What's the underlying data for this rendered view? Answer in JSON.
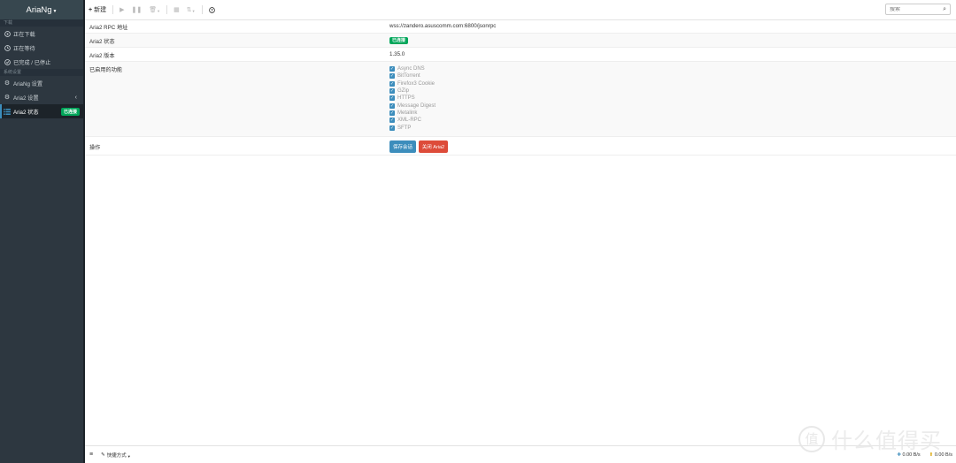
{
  "brand": {
    "title": "AriaNg"
  },
  "sidebar": {
    "section_downloads": "下载",
    "downloads": [
      {
        "label": "正在下载",
        "icon": "play-circle-icon"
      },
      {
        "label": "正在等待",
        "icon": "clock-icon"
      },
      {
        "label": "已完成 / 已停止",
        "icon": "check-circle-icon"
      }
    ],
    "section_settings": "系统设置",
    "settings": [
      {
        "label": "AriaNg 设置",
        "icon": "gear-icon"
      },
      {
        "label": "Aria2 设置",
        "icon": "gears-icon"
      },
      {
        "label": "Aria2 状态",
        "icon": "server-icon",
        "badge": "已连接",
        "active": true
      }
    ]
  },
  "toolbar": {
    "new_label": "新建",
    "search_placeholder": "搜索"
  },
  "status": {
    "rpc_label": "Aria2 RPC 地址",
    "rpc_value": "wss://zandero.asuscomm.com:6800/jsonrpc",
    "state_label": "Aria2 状态",
    "state_value": "已连接",
    "version_label": "Aria2 版本",
    "version_value": "1.35.0",
    "features_label": "已启用的功能",
    "features": [
      "Async DNS",
      "BitTorrent",
      "Firefox3 Cookie",
      "GZip",
      "HTTPS",
      "Message Digest",
      "Metalink",
      "XML-RPC",
      "SFTP"
    ],
    "actions_label": "操作",
    "save_session": "保存会话",
    "shutdown": "关闭 Aria2"
  },
  "footer": {
    "shortcut_label": "快捷方式",
    "download_speed": "0.00 B/s",
    "upload_speed": "0.00 B/s"
  },
  "watermark": {
    "text": "什么值得买",
    "icon_char": "值"
  },
  "colors": {
    "sidebar": "#2d3740",
    "accent": "#3c8dbc",
    "success": "#00a65a",
    "danger": "#dd4b39"
  }
}
